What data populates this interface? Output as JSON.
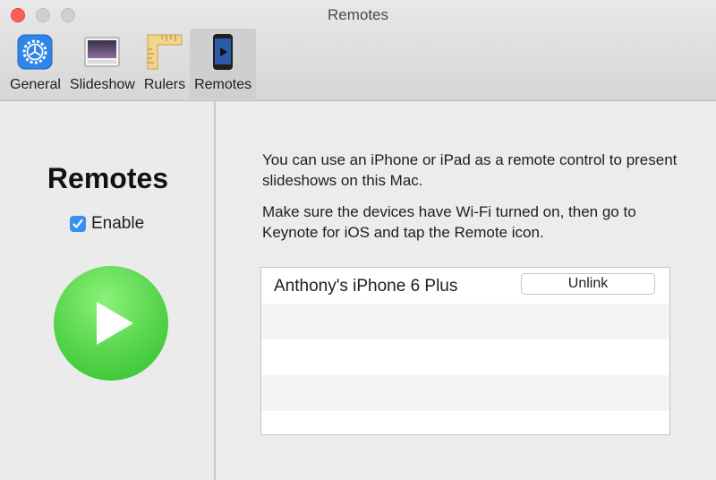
{
  "window": {
    "title": "Remotes"
  },
  "toolbar": {
    "tabs": [
      {
        "label": "General",
        "icon": "gear-icon"
      },
      {
        "label": "Slideshow",
        "icon": "slideshow-icon"
      },
      {
        "label": "Rulers",
        "icon": "ruler-icon"
      },
      {
        "label": "Remotes",
        "icon": "iphone-remote-icon"
      }
    ],
    "active_tab": "Remotes"
  },
  "left": {
    "title": "Remotes",
    "enable_label": "Enable",
    "enable_checked": true,
    "play_icon": "play-icon"
  },
  "right": {
    "description_1": "You can use an iPhone or iPad as a remote control to present slideshows on this Mac.",
    "description_2": "Make sure the devices have Wi-Fi turned on, then go to Keynote for iOS and tap the Remote icon.",
    "devices": [
      {
        "name": "Anthony's iPhone 6 Plus",
        "action_label": "Unlink"
      }
    ]
  },
  "colors": {
    "accent": "#3b8ff0",
    "close_button": "#fc5f57",
    "play_green": "#4cd04a"
  }
}
